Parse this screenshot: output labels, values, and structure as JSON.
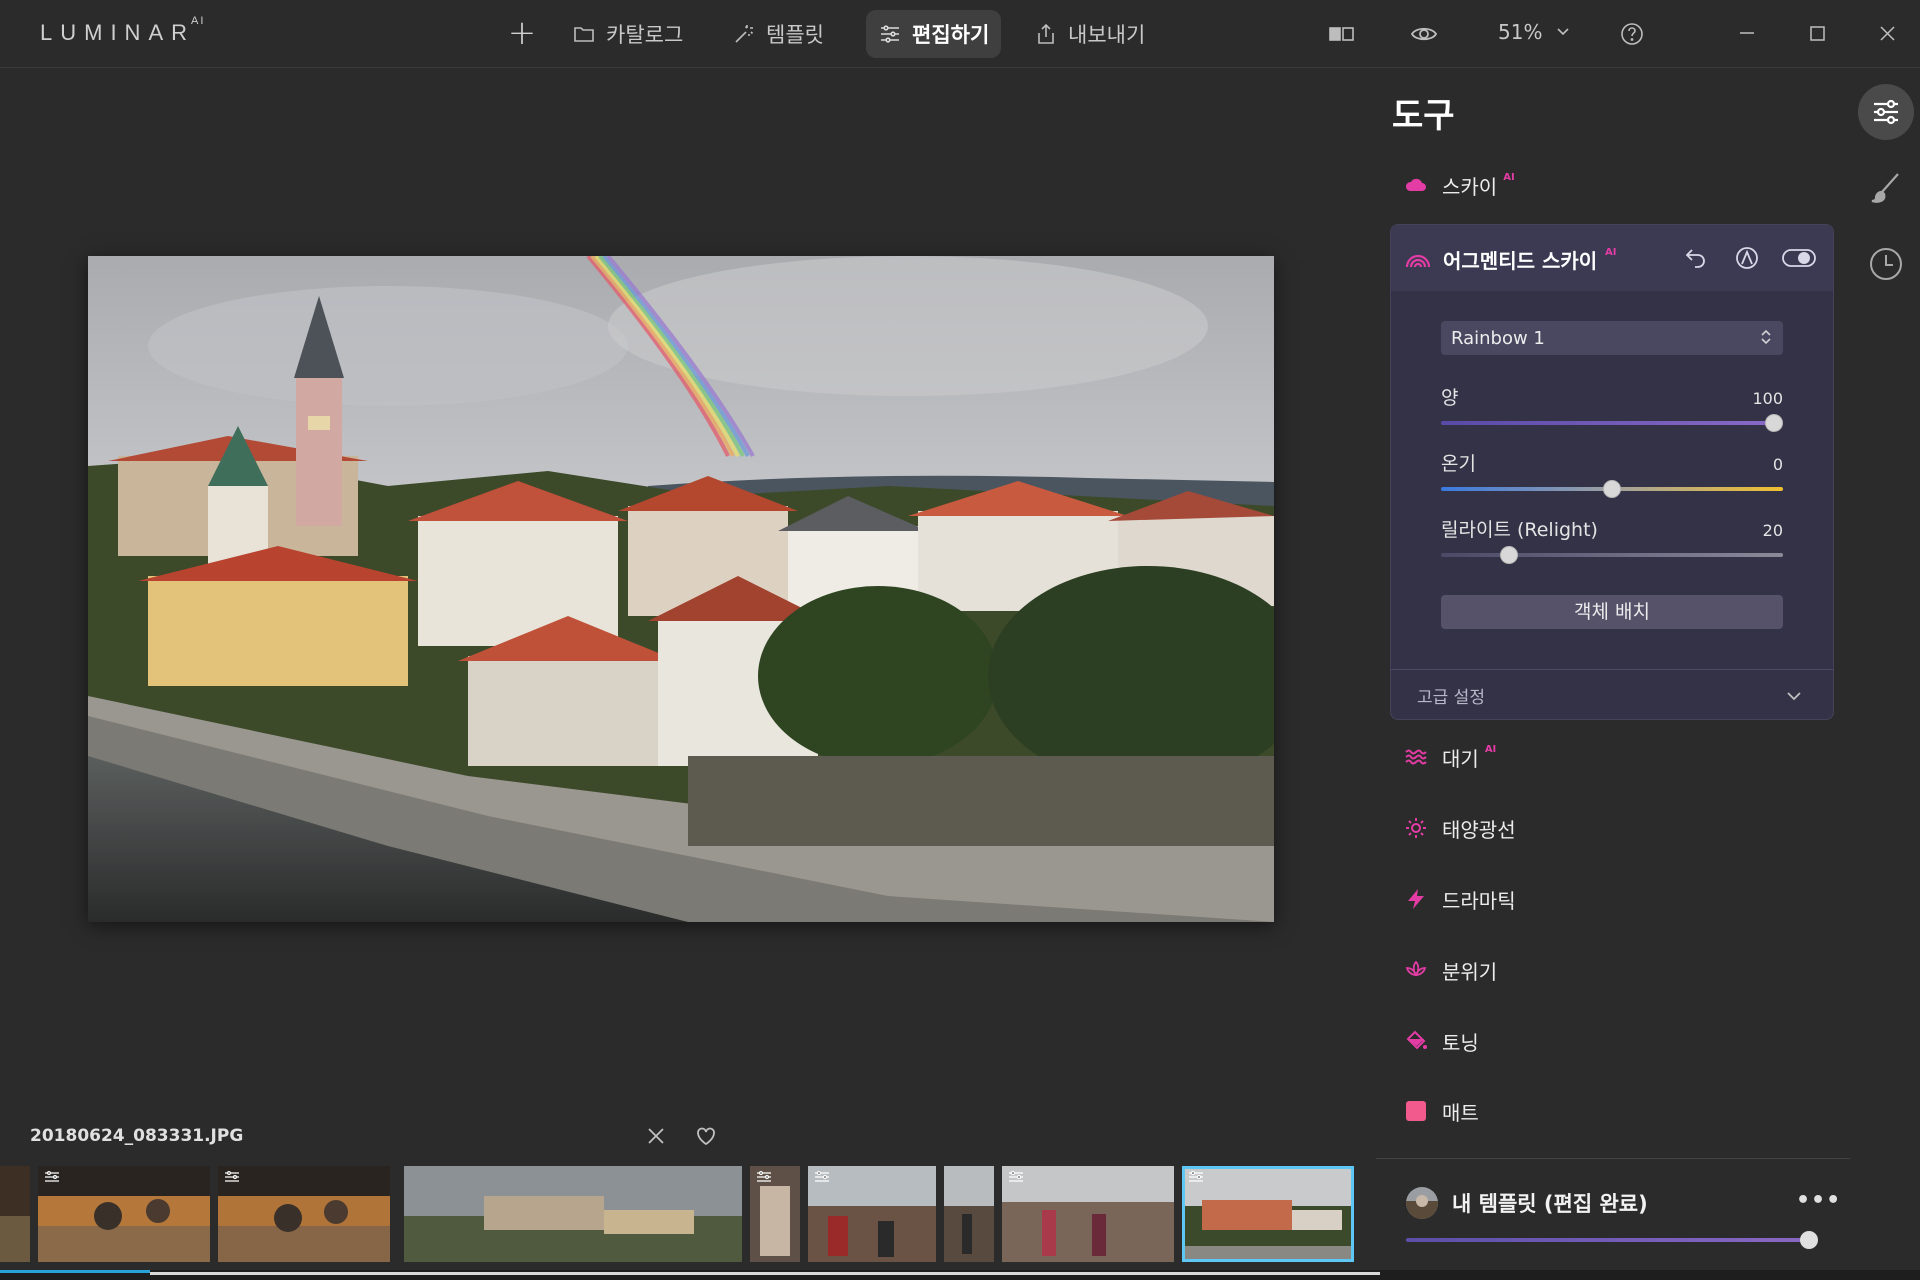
{
  "app": {
    "logo": "LUMINAR",
    "logo_sup": "AI"
  },
  "nav": {
    "catalog": "카탈로그",
    "templates": "템플릿",
    "edit": "편집하기",
    "export": "내보내기"
  },
  "toolbar": {
    "zoom": "51%"
  },
  "file": {
    "name": "20180624_083331.JPG"
  },
  "panel": {
    "title": "도구",
    "ai_badge": "AI",
    "sky": "스카이",
    "augmented_sky": {
      "title": "어그멘티드 스카이",
      "preset": "Rainbow 1",
      "sliders": [
        {
          "label": "양",
          "value": "100",
          "level": 1.0
        },
        {
          "label": "온기",
          "value": "0",
          "level": 0.5
        },
        {
          "label": "릴라이트 (Relight)",
          "value": "20",
          "level": 0.2
        }
      ],
      "object_button": "객체 배치",
      "advanced": "고급 설정"
    },
    "tools": [
      {
        "label": "대기",
        "ai": true,
        "icon": "atmosphere-icon"
      },
      {
        "label": "태양광선",
        "ai": false,
        "icon": "sun-rays-icon"
      },
      {
        "label": "드라마틱",
        "ai": false,
        "icon": "lightning-icon"
      },
      {
        "label": "분위기",
        "ai": false,
        "icon": "lotus-icon"
      },
      {
        "label": "토닝",
        "ai": false,
        "icon": "paint-bucket-icon"
      },
      {
        "label": "매트",
        "ai": false,
        "icon": "matte-square-icon"
      }
    ],
    "template": {
      "label": "내 템플릿 (편집 완료)",
      "more": "•••",
      "level": 1.0
    }
  },
  "colors": {
    "accent_pink": "#e43ca5",
    "selection_blue": "#5ec7f5",
    "panel_card": "#343247"
  }
}
